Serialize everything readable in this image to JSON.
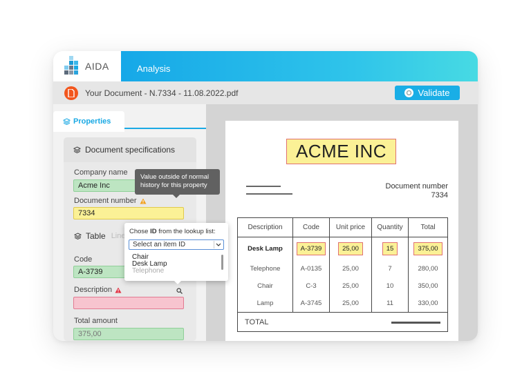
{
  "app": {
    "brand": "AIDA",
    "tab": "Analysis"
  },
  "document": {
    "file_name": "Your Document - N.7334 - 11.08.2022.pdf",
    "validate_label": "Validate"
  },
  "properties": {
    "tab_label": "Properties",
    "section_title": "Document specifications",
    "company_label": "Company name",
    "company_value": "Acme Inc",
    "docnum_label": "Document number",
    "docnum_value": "7334",
    "table_label": "Table",
    "table_sub": "Line",
    "code_label": "Code",
    "code_value": "A-3739",
    "description_label": "Description",
    "description_value": "",
    "total_label": "Total amount",
    "total_value": "375,00"
  },
  "tooltip": {
    "line1": "Value outside of normal",
    "line2": "history for this property"
  },
  "lookup": {
    "title_pre": "Chose ",
    "title_bold": "ID",
    "title_post": " from the lookup list:",
    "placeholder": "Select an item ID",
    "options": [
      "Chair",
      "Desk Lamp",
      "Telephone"
    ]
  },
  "invoice": {
    "company": "ACME INC",
    "docnum_label": "Document number",
    "docnum_value": "7334",
    "columns": [
      "Description",
      "Code",
      "Unit price",
      "Quantity",
      "Total"
    ],
    "rows": [
      [
        "Desk Lamp",
        "A-3739",
        "25,00",
        "15",
        "375,00"
      ],
      [
        "Telephone",
        "A-0135",
        "25,00",
        "7",
        "280,00"
      ],
      [
        "Chair",
        "C-3",
        "25,00",
        "10",
        "350,00"
      ],
      [
        "Lamp",
        "A-3745",
        "25,00",
        "11",
        "330,00"
      ]
    ],
    "total_label": "TOTAL"
  },
  "colors": {
    "accent": "#1aa9e4",
    "highlight_yellow": "#fbf196",
    "highlight_green": "#bde5c2",
    "highlight_pink": "#f7c4cf",
    "pdf_orange": "#f2561d",
    "warn_orange": "#f0a020",
    "error_red": "#e23344"
  },
  "icons": [
    "aida-logo-icon",
    "pdf-icon",
    "validate-icon",
    "layers-icon",
    "warning-icon",
    "search-icon",
    "chevron-down-icon"
  ]
}
